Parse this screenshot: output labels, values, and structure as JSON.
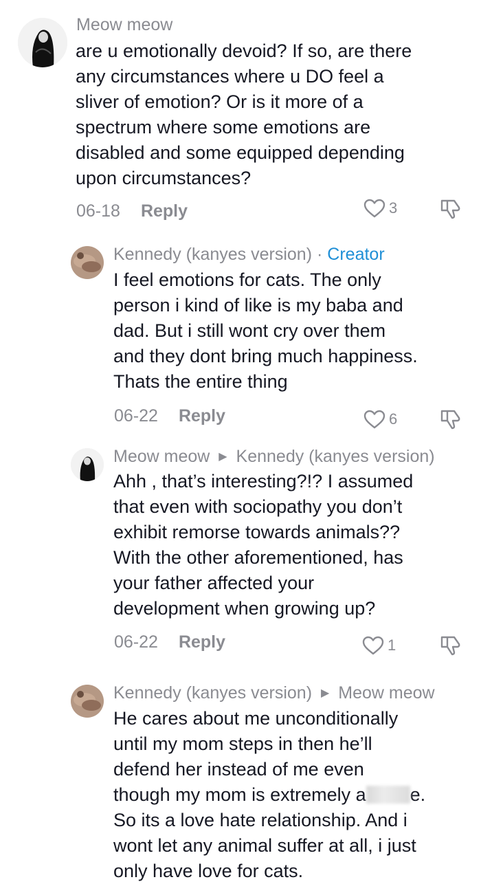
{
  "comments": [
    {
      "author": "Meow meow",
      "lines": [
        "are u emotionally devoid? If so, are there",
        "any circumstances where u DO feel a",
        "sliver of emotion? Or is it more of a",
        "spectrum where some emotions are",
        "disabled and some equipped depending",
        "upon circumstances?"
      ],
      "date": "06-18",
      "reply_label": "Reply",
      "likes": "3"
    },
    {
      "author": "Kennedy (kanyes version)",
      "separator": "·",
      "badge": "Creator",
      "lines": [
        "I feel emotions for cats. The only",
        "person i kind of like is my baba and",
        "dad. But i still wont cry over them",
        "and they dont bring much happiness.",
        "Thats the entire thing"
      ],
      "date": "06-22",
      "reply_label": "Reply",
      "likes": "6"
    },
    {
      "author": "Meow meow",
      "reply_to": "Kennedy (kanyes version)",
      "lines": [
        "Ahh , that’s interesting?!? I assumed",
        "that even with sociopathy you don’t",
        "exhibit remorse towards animals??",
        "With the other aforementioned, has",
        "your father affected your",
        "development when growing up?"
      ],
      "date": "06-22",
      "reply_label": "Reply",
      "likes": "1"
    },
    {
      "author": "Kennedy (kanyes version)",
      "reply_to": "Meow meow",
      "lines": [
        "He cares about me unconditionally",
        "until my mom steps in then he’ll",
        "defend her instead of me even",
        "though my mom is extremely a",
        "So its a love hate relationship. And i",
        "wont let any animal suffer at all, i just",
        "only have love for cats."
      ],
      "line4_tail": "e.",
      "date": "",
      "reply_label": "",
      "likes": ""
    }
  ],
  "colors": {
    "text": "#161823",
    "muted": "#8a8b91",
    "creator": "#1f8fd6",
    "background": "#ffffff"
  },
  "icons": {
    "like": "heart-outline-icon",
    "dislike": "thumbs-down-outline-icon",
    "reply_arrow": "triangle-right-icon"
  }
}
